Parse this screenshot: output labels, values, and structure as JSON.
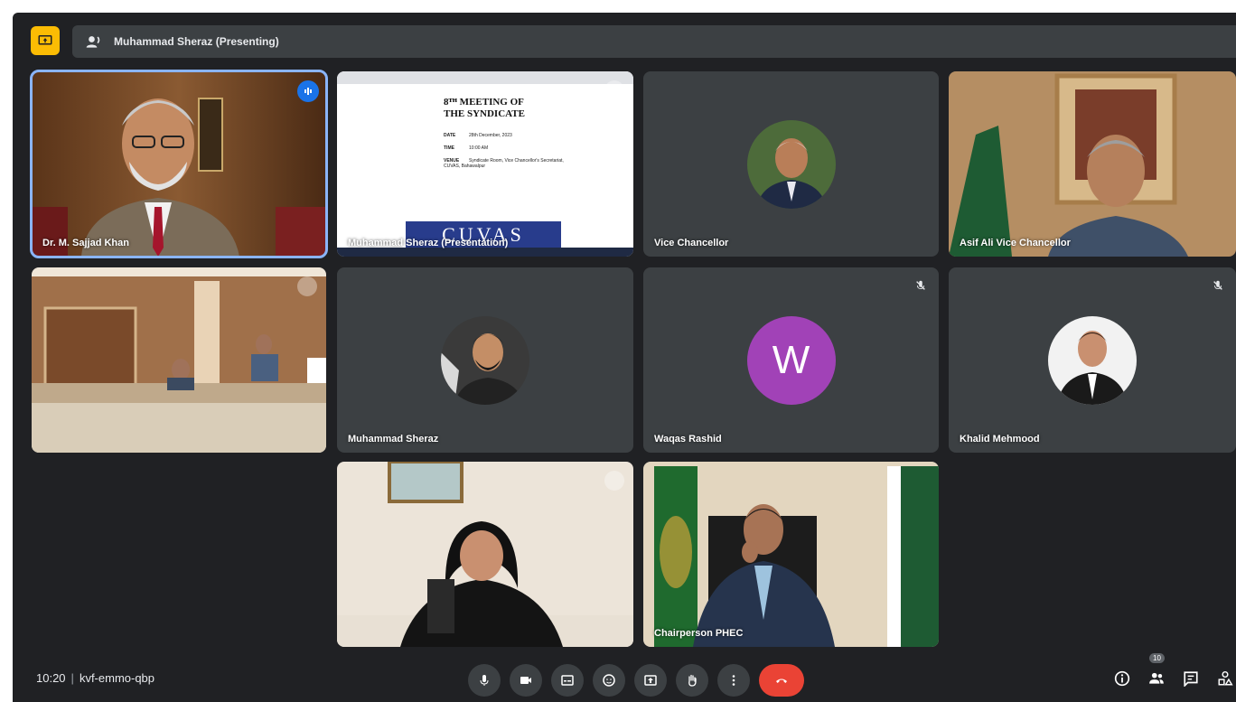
{
  "presenting_bar": {
    "text": "Muhammad Sheraz (Presenting)"
  },
  "tiles": [
    {
      "name": "Dr. M. Sajjad Khan",
      "type": "video",
      "speaking": true
    },
    {
      "name": "Muhammad Sheraz (Presentation)",
      "type": "screen"
    },
    {
      "name": "Vice Chancellor",
      "type": "avatar"
    },
    {
      "name": "Asif Ali Vice Chancellor",
      "type": "video"
    },
    {
      "name": "",
      "type": "video"
    },
    {
      "name": "Muhammad Sheraz",
      "type": "avatar"
    },
    {
      "name": "Waqas Rashid",
      "type": "letter",
      "letter": "W",
      "muted": true
    },
    {
      "name": "Khalid Mehmood",
      "type": "avatar",
      "muted": true
    },
    {
      "name": "",
      "type": "video"
    },
    {
      "name": "Chairperson PHEC",
      "type": "video"
    }
  ],
  "slide": {
    "heading_line1": "8ᵀᴴ MEETING OF",
    "heading_line2": "THE SYNDICATE",
    "rows": [
      {
        "label": "DATE",
        "value": "28th December, 2023"
      },
      {
        "label": "TIME",
        "value": "10:00 AM"
      },
      {
        "label": "VENUE",
        "value": "Syndicate Room, Vice Chancellor's Secretariat, CUVAS, Bahawalpur"
      }
    ],
    "banner": "CUVAS"
  },
  "bottom_bar": {
    "time": "10:20",
    "meeting_code": "kvf-emmo-qbp",
    "participant_count": "10"
  },
  "colors": {
    "background": "#202124",
    "tile": "#3c4043",
    "accent": "#8ab4f8",
    "hangup": "#ea4335",
    "present_badge": "#fbbc04",
    "avatar_w": "#a142b7"
  }
}
